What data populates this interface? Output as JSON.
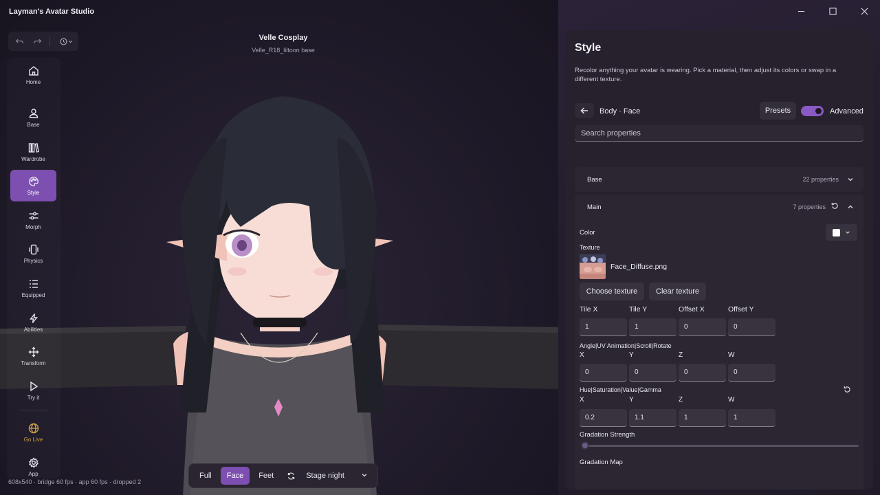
{
  "app": {
    "title": "Layman's Avatar Studio"
  },
  "history": {
    "undo_icon": "undo-icon",
    "redo_icon": "redo-icon",
    "history_icon": "history-icon"
  },
  "sidebar": {
    "items": [
      {
        "label": "Home",
        "icon": "home-icon"
      },
      {
        "label": "Base",
        "icon": "person-icon"
      },
      {
        "label": "Wardrobe",
        "icon": "library-icon"
      },
      {
        "label": "Style",
        "icon": "palette-icon",
        "active": true
      },
      {
        "label": "Morph",
        "icon": "sliders-icon"
      },
      {
        "label": "Physics",
        "icon": "phone-vibrate-icon"
      },
      {
        "label": "Equipped",
        "icon": "list-icon"
      },
      {
        "label": "Abilities",
        "icon": "lightning-icon"
      },
      {
        "label": "Transform",
        "icon": "move-icon"
      },
      {
        "label": "Try it",
        "icon": "play-icon"
      },
      {
        "label": "Go Live",
        "icon": "globe-icon",
        "accent": "#c9a248"
      },
      {
        "label": "App",
        "icon": "gear-icon"
      }
    ]
  },
  "stage": {
    "title": "Velle Cosplay",
    "subtitle": "Velle_R18_liltoon base",
    "camera": {
      "views": [
        "Full",
        "Face",
        "Feet"
      ],
      "active_view": "Face",
      "environment": "Stage night"
    },
    "status": "608x540 · bridge 60 fps · app 60 fps · dropped 2"
  },
  "panel": {
    "title": "Style",
    "description": "Recolor anything your avatar is wearing. Pick a material, then adjust its colors or swap in a different texture.",
    "breadcrumb": "Body · Face",
    "presets_label": "Presets",
    "advanced_label": "Advanced",
    "advanced_on": true,
    "search_placeholder": "Search properties",
    "sections": [
      {
        "name": "Base",
        "count": "22 properties",
        "expanded": false
      },
      {
        "name": "Main",
        "count": "7 properties",
        "expanded": true
      }
    ],
    "main": {
      "color_label": "Color",
      "color_value": "#ffffff",
      "texture_label": "Texture",
      "texture_file": "Face_Diffuse.png",
      "choose_texture": "Choose texture",
      "clear_texture": "Clear texture",
      "tile_offset": {
        "labels": [
          "Tile X",
          "Tile Y",
          "Offset X",
          "Offset Y"
        ],
        "values": [
          "1",
          "1",
          "0",
          "0"
        ]
      },
      "angle": {
        "label": "Angle|UV Animation|Scroll|Rotate",
        "axes": [
          "X",
          "Y",
          "Z",
          "W"
        ],
        "values": [
          "0",
          "0",
          "0",
          "0"
        ]
      },
      "hsv": {
        "label": "Hue|Saturation|Value|Gamma",
        "axes": [
          "X",
          "Y",
          "Z",
          "W"
        ],
        "values": [
          "0.2",
          "1.1",
          "1",
          "1"
        ]
      },
      "gradation_strength_label": "Gradation Strength",
      "gradation_strength": 0,
      "gradation_map_label": "Gradation Map"
    }
  },
  "colors": {
    "accent": "#7c4fb0",
    "golive": "#c9a248"
  }
}
